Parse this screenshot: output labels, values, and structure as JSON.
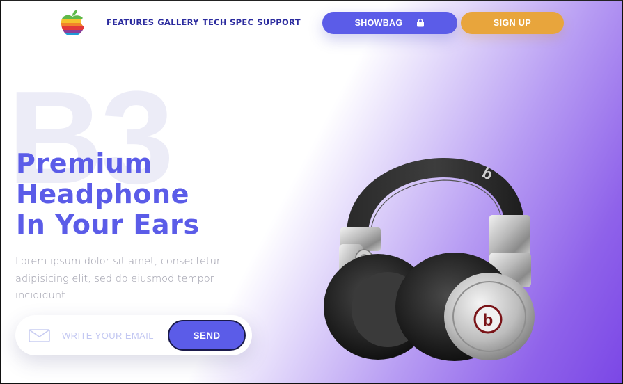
{
  "nav": {
    "links": [
      "FEATURES",
      "GALLERY",
      "TECH SPEC",
      "SUPPORT"
    ],
    "showbag_label": "SHOWBAG",
    "signup_label": "SIGN UP",
    "logo_icon": "rainbow-apple-logo",
    "bag_icon": "shopping-bag-icon"
  },
  "hero": {
    "watermark": "B3",
    "headline": [
      "Premium",
      "Headphone",
      "In Your Ears"
    ],
    "description": "Lorem ipsum dolor sit amet, consectetur adipisicing elit, sed do eiusmod tempor incididunt.",
    "email_placeholder": "WRITE YOUR EMAIL",
    "send_label": "SEND",
    "mail_icon": "envelope-icon",
    "product_logo": "b"
  },
  "colors": {
    "primary": "#5b5ce8",
    "accent": "#e8a53c",
    "gradient_end": "#7b47e6",
    "text_muted": "#9a9aa8"
  }
}
